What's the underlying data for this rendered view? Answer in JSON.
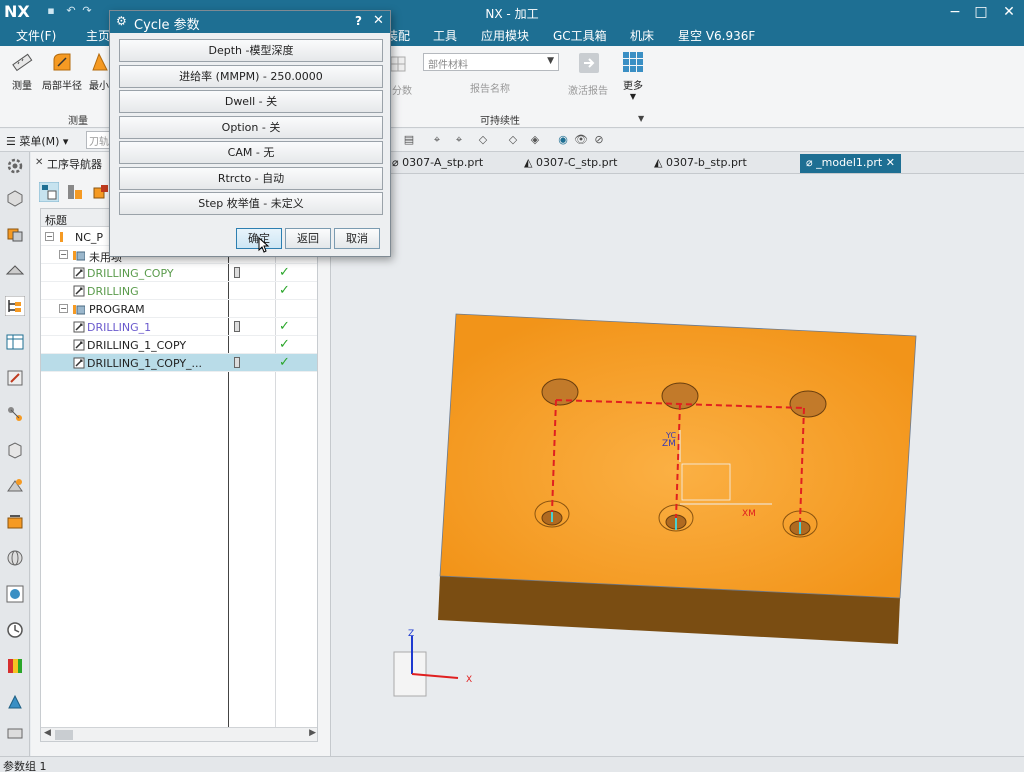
{
  "app": {
    "logo": "NX",
    "title": "NX - 加工"
  },
  "menubar": {
    "items": [
      "文件(F)",
      "主页",
      "装配",
      "工具",
      "应用模块",
      "GC工具箱",
      "机床",
      "星空 V6.936F"
    ]
  },
  "ribbon": {
    "buttons": [
      {
        "label": "测量"
      },
      {
        "label": "局部半径"
      },
      {
        "label": "最小"
      }
    ],
    "group_measure": "测量",
    "part_material_select": "部件材料",
    "report_name": "报告名称",
    "sim_report": "激活报告",
    "more": "更多",
    "group_sustain": "可持续性",
    "muted_label": "分数"
  },
  "cmdbar": {
    "menu_label": "菜单(M)",
    "tool_filter": "刀轨"
  },
  "navigator": {
    "title": "工序导航器",
    "column_header": "标题",
    "rows": [
      {
        "label": "NC_P",
        "indent": 0,
        "color": "#222222",
        "type": "root",
        "toggle": "−"
      },
      {
        "label": "未用项",
        "indent": 1,
        "color": "#222222",
        "type": "folder",
        "toggle": "−"
      },
      {
        "label": "DRILLING_COPY",
        "indent": 2,
        "color": "#5a9b4c",
        "type": "op",
        "tool": true,
        "check": true
      },
      {
        "label": "DRILLING",
        "indent": 2,
        "color": "#5a9b4c",
        "type": "op",
        "tool": false,
        "check": true
      },
      {
        "label": "PROGRAM",
        "indent": 1,
        "color": "#222222",
        "type": "folder",
        "toggle": "−"
      },
      {
        "label": "DRILLING_1",
        "indent": 2,
        "color": "#6a5acd",
        "type": "op",
        "tool": true,
        "check": true
      },
      {
        "label": "DRILLING_1_COPY",
        "indent": 2,
        "color": "#222222",
        "type": "op",
        "tool": false,
        "check": true
      },
      {
        "label": "DRILLING_1_COPY_...",
        "indent": 2,
        "color": "#222222",
        "type": "op",
        "tool": true,
        "check": true,
        "selected": true
      }
    ]
  },
  "tabs": [
    {
      "label": "0307-A_stp.prt"
    },
    {
      "label": "0307-C_stp.prt"
    },
    {
      "label": "0307-b_stp.prt"
    },
    {
      "label": "_model1.prt",
      "active": true
    }
  ],
  "dialog": {
    "title": "Cycle 参数",
    "params": [
      "Depth -模型深度",
      "进给率 (MMPM) - 250.0000",
      "Dwell - 关",
      "Option - 关",
      "CAM - 无",
      "Rtrcto - 自动",
      "Step 枚举值 - 未定义"
    ],
    "ok": "确定",
    "back": "返回",
    "cancel": "取消"
  },
  "viewport": {
    "labels": {
      "zm": "ZM",
      "yc": "YC",
      "xm": "XM",
      "x_axis": "X",
      "z_axis": "Z"
    }
  },
  "status": "参数组 1",
  "colors": {
    "accent": "#1e6f93",
    "part_top": "#f59a23",
    "part_side": "#7a4d12",
    "toolpath": "#e02020",
    "check": "#2aa62a"
  }
}
